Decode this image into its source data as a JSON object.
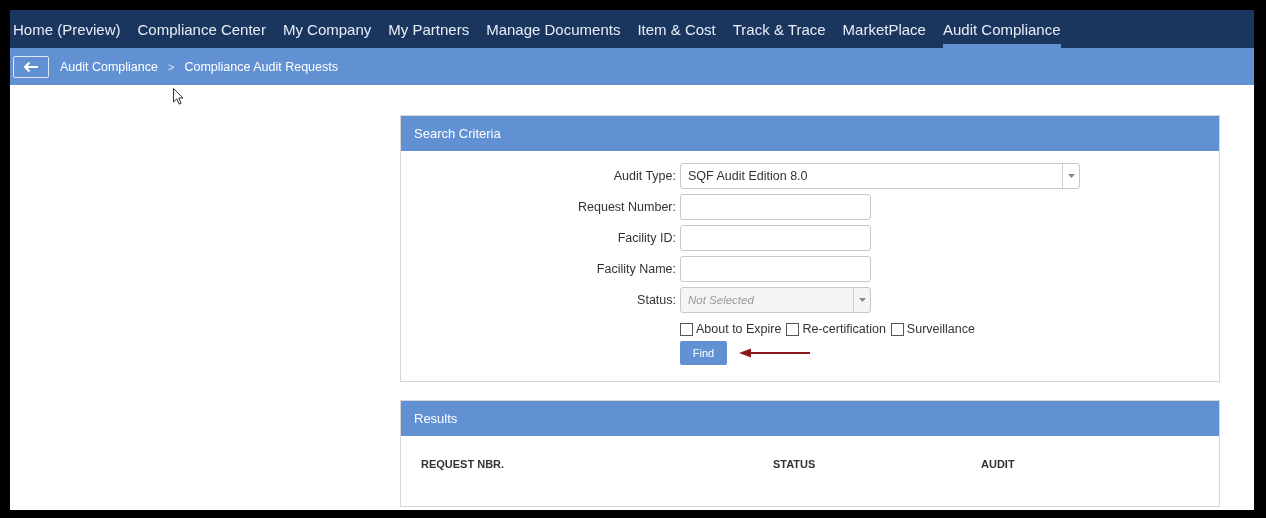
{
  "nav": [
    {
      "label": "Home (Preview)",
      "selected": false
    },
    {
      "label": "Compliance Center",
      "selected": false
    },
    {
      "label": "My Company",
      "selected": false
    },
    {
      "label": "My Partners",
      "selected": false
    },
    {
      "label": "Manage Documents",
      "selected": false
    },
    {
      "label": "Item & Cost",
      "selected": false
    },
    {
      "label": "Track & Trace",
      "selected": false
    },
    {
      "label": "MarketPlace",
      "selected": false
    },
    {
      "label": "Audit Compliance",
      "selected": true
    }
  ],
  "breadcrumb": {
    "items": [
      "Audit Compliance",
      "Compliance Audit Requests"
    ],
    "separator": ">"
  },
  "search_criteria": {
    "title": "Search Criteria",
    "fields": [
      {
        "kind": "select",
        "label": "Audit Type:",
        "value": "SQF Audit Edition 8.0",
        "wide": true
      },
      {
        "kind": "text",
        "label": "Request Number:"
      },
      {
        "kind": "text",
        "label": "Facility ID:"
      },
      {
        "kind": "text",
        "label": "Facility Name:"
      },
      {
        "kind": "select",
        "label": "Status:",
        "placeholder": "Not Selected"
      }
    ],
    "checkboxes": [
      {
        "label": "About to Expire",
        "checked": false
      },
      {
        "label": "Re-certification",
        "checked": false
      },
      {
        "label": "Surveillance",
        "checked": false
      }
    ],
    "button": "Find"
  },
  "results": {
    "title": "Results",
    "columns": [
      "REQUEST NBR.",
      "STATUS",
      "AUDIT"
    ]
  }
}
